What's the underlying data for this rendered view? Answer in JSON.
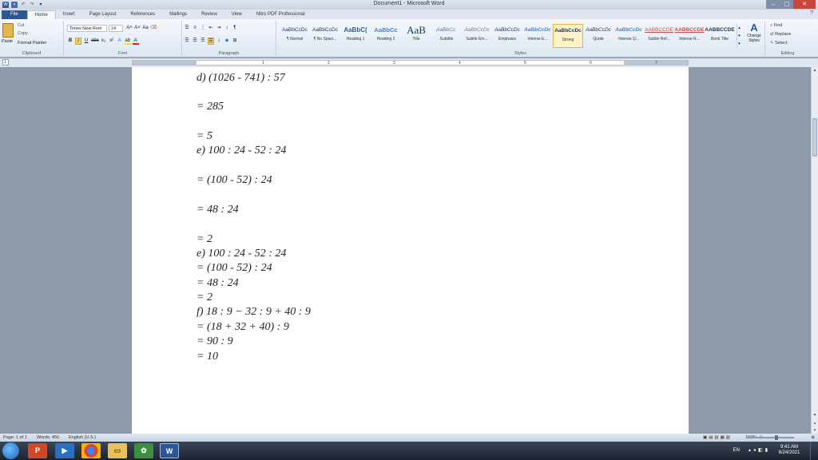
{
  "window": {
    "title": "Document1 - Microsoft Word",
    "qat": [
      "save-icon",
      "undo-icon",
      "redo-icon",
      "customize-icon"
    ]
  },
  "tabs": [
    "File",
    "Home",
    "Insert",
    "Page Layout",
    "References",
    "Mailings",
    "Review",
    "View",
    "Nitro PDF Professional"
  ],
  "active_tab": "Home",
  "ribbon": {
    "clipboard": {
      "paste": "Paste",
      "cut": "Cut",
      "copy": "Copy",
      "format_painter": "Format Painter",
      "label": "Clipboard"
    },
    "font": {
      "name": "Times New Rom",
      "size": "14",
      "grow": "A˄",
      "shrink": "A˅",
      "case": "Aa",
      "bold": "B",
      "italic": "I",
      "underline": "U",
      "strike": "abc",
      "sub": "x₂",
      "sup": "x²",
      "highlight": "ab",
      "color": "A",
      "label": "Font"
    },
    "paragraph": {
      "label": "Paragraph",
      "pilcrow": "¶"
    },
    "styles": {
      "label": "Styles",
      "items": [
        {
          "sample": "AaBbCcDc",
          "name": "¶ Normal"
        },
        {
          "sample": "AaBbCcDc",
          "name": "¶ No Spaci..."
        },
        {
          "sample": "AaBbC(",
          "name": "Heading 1"
        },
        {
          "sample": "AaBbCc",
          "name": "Heading 2"
        },
        {
          "sample": "AaB",
          "name": "Title"
        },
        {
          "sample": "AaBbCc.",
          "name": "Subtitle"
        },
        {
          "sample": "AaBbCcDc",
          "name": "Subtle Em..."
        },
        {
          "sample": "AaBbCcDc",
          "name": "Emphasis"
        },
        {
          "sample": "AaBbCcDc",
          "name": "Intense E..."
        },
        {
          "sample": "AaBbCcDc",
          "name": "Strong"
        },
        {
          "sample": "AaBbCcDc",
          "name": "Quote"
        },
        {
          "sample": "AaBbCcDc",
          "name": "Intense Q..."
        },
        {
          "sample": "AABBCCDE",
          "name": "Subtle Ref..."
        },
        {
          "sample": "AABBCCDE",
          "name": "Intense R..."
        },
        {
          "sample": "AABBCCDE",
          "name": "Book Title"
        }
      ],
      "selected": "Strong",
      "change_styles": "Change Styles"
    },
    "editing": {
      "find": "Find",
      "replace": "Replace",
      "select": "Select",
      "label": "Editing"
    }
  },
  "ruler": {
    "numbers": [
      "1",
      "2",
      "3",
      "4",
      "5",
      "6",
      "7"
    ],
    "tab_selector": "L"
  },
  "document": {
    "lines": [
      "d) (1026 - 741) : 57",
      "= 285",
      "= 5",
      "e) 100 : 24 - 52 : 24",
      "= (100 - 52) : 24",
      "= 48 : 24",
      "= 2",
      "e) 100 : 24 - 52 : 24",
      "= (100 - 52) : 24",
      "= 48 : 24",
      "= 2",
      "f) 18 : 9 − 32 : 9 + 40 : 9",
      "= (18 + 32 + 40) : 9",
      "= 90 : 9",
      "= 10"
    ]
  },
  "status": {
    "page": "Page: 1 of 1",
    "words": "Words: 450",
    "language": "English (U.S.)",
    "zoom": "160%"
  },
  "taskbar": {
    "apps": [
      "powerpoint-icon",
      "media-player-icon",
      "chrome-icon",
      "file-explorer-icon",
      "game-icon",
      "word-icon"
    ],
    "lang": "EN",
    "time": "9:41 AM",
    "date": "6/24/2021"
  }
}
